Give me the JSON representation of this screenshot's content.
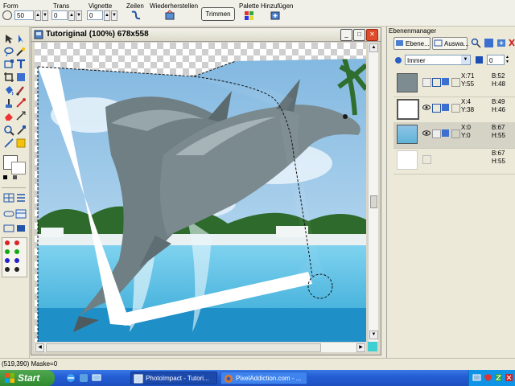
{
  "toolbar": {
    "form_label": "Form",
    "form_value": "50",
    "trans_label": "Trans",
    "trans_value": "0",
    "vignette_label": "Vignette",
    "vignette_value": "0",
    "zeilen_label": "Zeilen",
    "restore_label": "Wiederherstellen",
    "trim_label": "Trimmen",
    "palette_label": "Palette",
    "add_label": "Hinzufügen"
  },
  "document": {
    "title": "Tutoriginal (100%) 678x558",
    "minimize_glyph": "_",
    "maximize_glyph": "□",
    "close_glyph": "✕"
  },
  "panel": {
    "title": "Ebenenmanager",
    "tab_layers": "Ebene...",
    "tab_select": "Auswa...",
    "mode": "Immer",
    "opacity": "0",
    "layers": [
      {
        "x": "X:71",
        "y": "Y:55",
        "b1": "B:52",
        "b2": "H:48"
      },
      {
        "x": "X:4",
        "y": "Y:38",
        "b1": "B:49",
        "b2": "H:46"
      },
      {
        "x": "X:0",
        "y": "Y:0",
        "b1": "B:67",
        "b2": "H:55"
      },
      {
        "x": "",
        "y": "",
        "b1": "B:67",
        "b2": "H:55"
      }
    ]
  },
  "status": {
    "text": "(519,390) Maske=0"
  },
  "taskbar": {
    "start_label": "Start",
    "task1": "PhotoImpact - Tutori...",
    "task2": "PixelAddiction.com - ..."
  },
  "colors": {
    "titlebar": "#dcdac9",
    "taskbar": "#245ed4",
    "start": "#2f8a2f",
    "close": "#e04b2b",
    "sky": "#9ecde8",
    "water": "#5fc4e6",
    "dolphin": "#6f7f84"
  }
}
